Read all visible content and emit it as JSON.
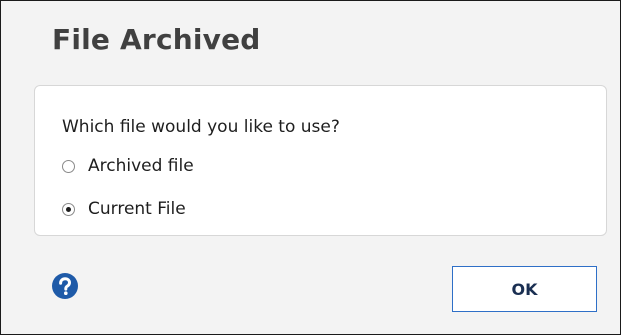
{
  "dialog": {
    "title": "File Archived",
    "question": "Which file would you like to use?",
    "options": [
      {
        "label": "Archived file",
        "selected": false
      },
      {
        "label": "Current File",
        "selected": true
      }
    ],
    "help_icon": "help-question-icon",
    "ok_label": "OK"
  },
  "colors": {
    "background": "#f3f3f3",
    "panel": "#ffffff",
    "accent": "#2e6fc7",
    "help_icon": "#1e5aa8"
  }
}
